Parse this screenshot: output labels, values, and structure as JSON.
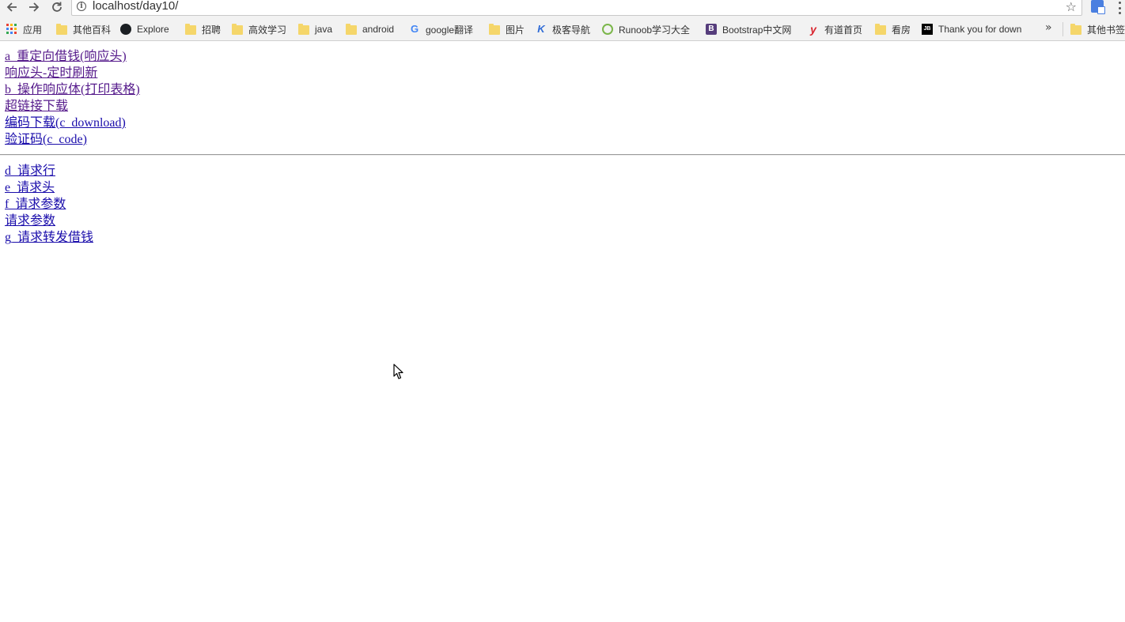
{
  "browser": {
    "url": "localhost/day10/",
    "bookmarks": [
      {
        "label": "应用",
        "icon": "apps-grid-icon"
      },
      {
        "label": "其他百科",
        "icon": "folder-icon"
      },
      {
        "label": "Explore",
        "icon": "github-icon"
      },
      {
        "label": "招聘",
        "icon": "folder-icon"
      },
      {
        "label": "高效学习",
        "icon": "folder-icon"
      },
      {
        "label": "java",
        "icon": "folder-icon"
      },
      {
        "label": "android",
        "icon": "folder-icon"
      },
      {
        "label": "google翻译",
        "icon": "google-icon"
      },
      {
        "label": "图片",
        "icon": "folder-icon"
      },
      {
        "label": "极客导航",
        "icon": "jk-icon"
      },
      {
        "label": "Runoob学习大全",
        "icon": "runoob-icon"
      },
      {
        "label": "Bootstrap中文网",
        "icon": "bootstrap-icon"
      },
      {
        "label": "有道首页",
        "icon": "youdao-icon"
      },
      {
        "label": "看房",
        "icon": "folder-icon"
      },
      {
        "label": "Thank you for down",
        "icon": "jetbrains-icon"
      }
    ],
    "overflow_chevron": "»",
    "other_bookmarks": "其他书签"
  },
  "page": {
    "links_group1": [
      "a_重定向借钱(响应头)",
      "响应头-定时刷新",
      "b_操作响应体(打印表格)",
      "超链接下载",
      "编码下载(c_download)",
      "验证码(c_code)"
    ],
    "links_group2": [
      "d_请求行",
      "e_请求头",
      "f_请求参数",
      "请求参数",
      "g_请求转发借钱"
    ]
  },
  "colors": {
    "link": "#1a0dab",
    "visited_link": "#551a8b",
    "chrome_bg": "#f2f2f2"
  }
}
